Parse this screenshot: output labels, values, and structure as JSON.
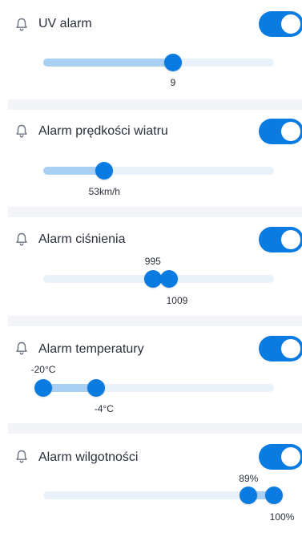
{
  "alarms": [
    {
      "title": "UV alarm",
      "enabled": true,
      "slider_type": "single",
      "min": 0,
      "max": 16,
      "value": 9,
      "value_label": "9"
    },
    {
      "title": "Alarm prędkości wiatru",
      "enabled": true,
      "slider_type": "single",
      "min": 0,
      "max": 200,
      "value": 53,
      "value_label": "53km/h"
    },
    {
      "title": "Alarm ciśnienia",
      "enabled": true,
      "slider_type": "range",
      "min": 900,
      "max": 1100,
      "low": 995,
      "high": 1009,
      "low_label": "995",
      "high_label": "1009"
    },
    {
      "title": "Alarm temperatury",
      "enabled": true,
      "slider_type": "range",
      "min": -20,
      "max": 50,
      "low": -20,
      "high": -4,
      "low_label": "-20°C",
      "high_label": "-4°C"
    },
    {
      "title": "Alarm wilgotności",
      "enabled": true,
      "slider_type": "range",
      "min": 0,
      "max": 100,
      "low": 89,
      "high": 100,
      "low_label": "89%",
      "high_label": "100%"
    }
  ],
  "colors": {
    "accent": "#0a7be0",
    "track": "#e9f2fb",
    "track_fill": "#a9d0f2",
    "divider": "#f2f4f8"
  },
  "icons": {
    "alarm": "bell-icon"
  }
}
